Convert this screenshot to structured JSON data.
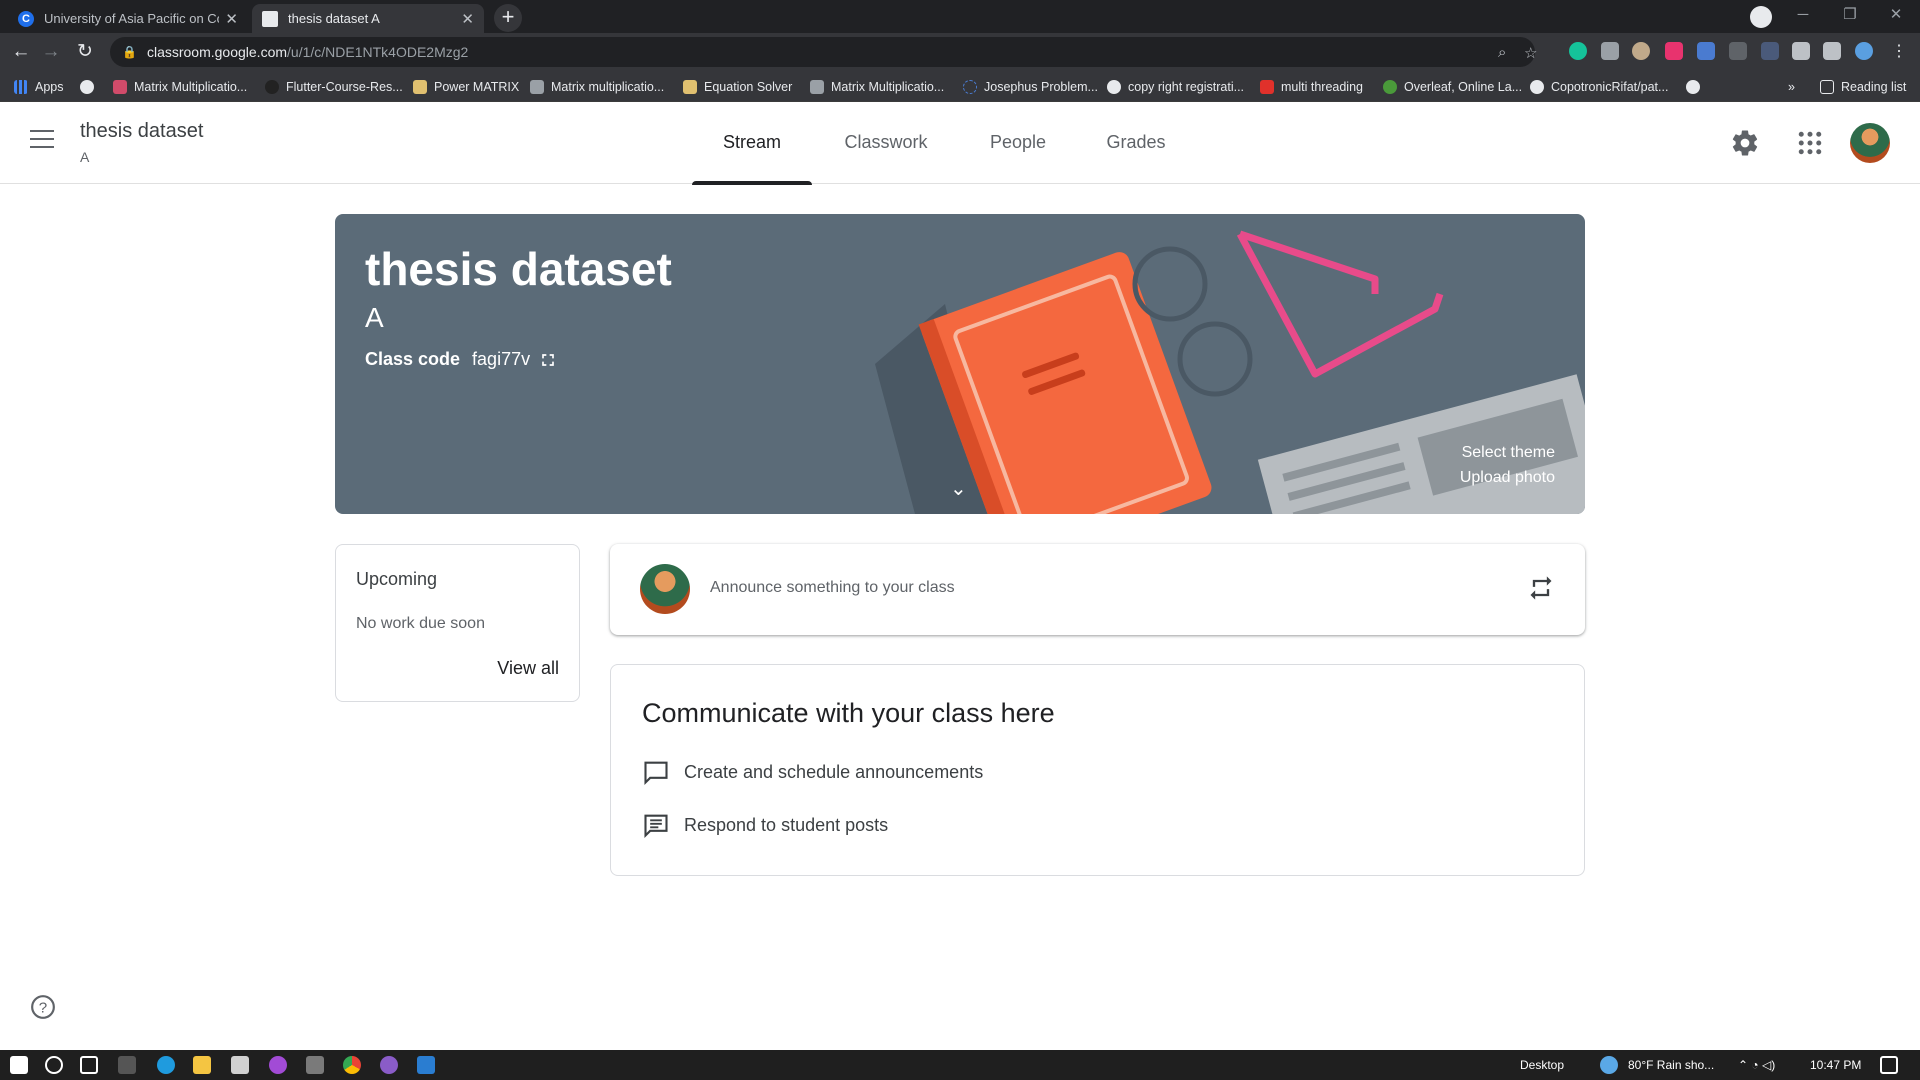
{
  "browser": {
    "tabs": [
      {
        "title": "University of Asia Pacific on Cour",
        "active": false
      },
      {
        "title": "thesis dataset A",
        "active": true
      }
    ],
    "new_tab": "+",
    "url_host": "classroom.google.com",
    "url_path": "/u/1/c/NDE1NTk4ODE2Mzg2",
    "bookmarks": [
      "Apps",
      "Matrix Multiplicatio...",
      "Flutter-Course-Res...",
      "Power MATRIX",
      "Matrix multiplicatio...",
      "Equation Solver",
      "Matrix Multiplicatio...",
      "Josephus Problem...",
      "copy right registrati...",
      "multi threading",
      "Overleaf, Online La...",
      "CopotronicRifat/pat..."
    ],
    "reading_list": "Reading list",
    "more": "»"
  },
  "header": {
    "class_name": "thesis dataset",
    "section": "A",
    "tabs": [
      "Stream",
      "Classwork",
      "People",
      "Grades"
    ],
    "active_tab": "Stream"
  },
  "banner": {
    "title": "thesis dataset",
    "section": "A",
    "class_code_label": "Class code",
    "class_code": "fagi77v",
    "select_theme": "Select theme",
    "upload_photo": "Upload photo"
  },
  "upcoming": {
    "title": "Upcoming",
    "empty": "No work due soon",
    "view_all": "View all"
  },
  "announce": {
    "placeholder": "Announce something to your class"
  },
  "communicate": {
    "title": "Communicate with your class here",
    "items": [
      "Create and schedule announcements",
      "Respond to student posts"
    ]
  },
  "taskbar": {
    "desktop": "Desktop",
    "weather": "80°F  Rain sho...",
    "time": "10:47 PM"
  },
  "colors": {
    "banner_bg": "#5b6b78",
    "book_orange": "#f4683f",
    "glasses_pink": "#e84b8a"
  }
}
